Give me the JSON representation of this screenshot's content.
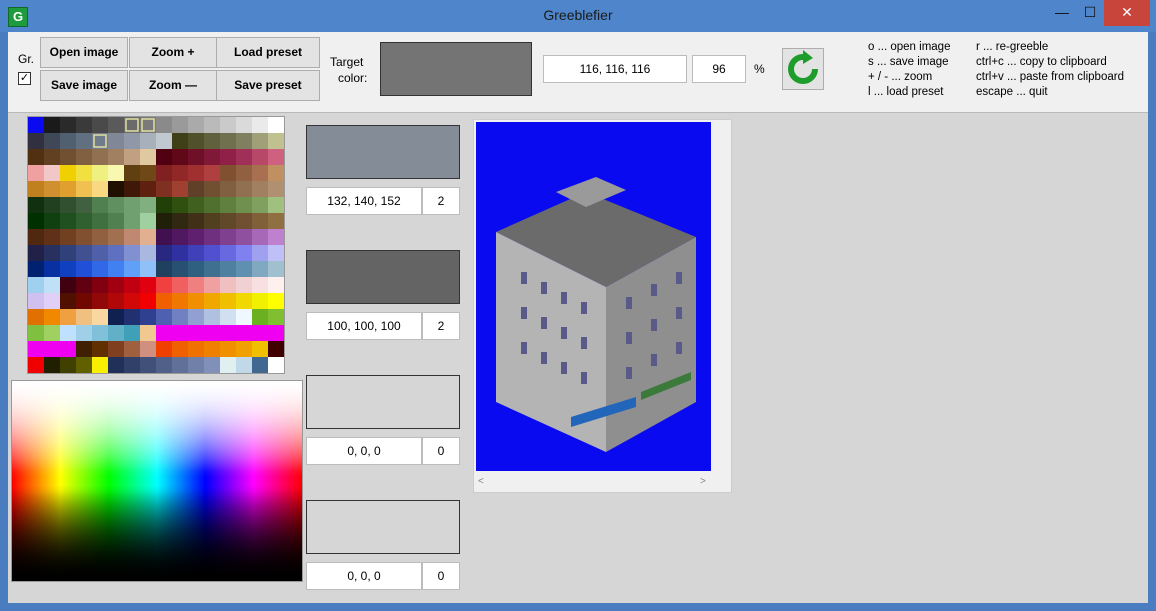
{
  "window": {
    "title": "Greeblefier",
    "app_icon": "G",
    "min": "—",
    "max": "☐",
    "close": "✕"
  },
  "toolbar": {
    "gr_label": "Gr.",
    "gr_checked": "✓",
    "open_image": "Open image",
    "save_image": "Save image",
    "zoom_in": "Zoom +",
    "zoom_out": "Zoom —",
    "load_preset": "Load preset",
    "save_preset": "Save preset",
    "target_color_label_1": "Target",
    "target_color_label_2": "color:",
    "target_color_value": "116, 116, 116",
    "target_color_hex": "#747474",
    "percent_value": "96",
    "percent_sign": "%",
    "refresh_icon": "refresh-icon"
  },
  "shortcuts": {
    "left": [
      "o  ...  open image",
      "s  ...  save image",
      "+ / -  ...  zoom",
      "l  ...  load preset"
    ],
    "right": [
      "r  ...  re-greeble",
      "ctrl+c ... copy to clipboard",
      "ctrl+v ... paste from clipboard",
      "escape  ...  quit"
    ]
  },
  "slots": [
    {
      "color": "#848c98",
      "rgb": "132, 140, 152",
      "count": "2"
    },
    {
      "color": "#646464",
      "rgb": "100, 100, 100",
      "count": "2"
    },
    {
      "color": "#d6d6d6",
      "rgb": "0, 0, 0",
      "count": "0"
    },
    {
      "color": "#d6d6d6",
      "rgb": "0, 0, 0",
      "count": "0"
    }
  ],
  "preview": {
    "background": "#0a0af0"
  }
}
